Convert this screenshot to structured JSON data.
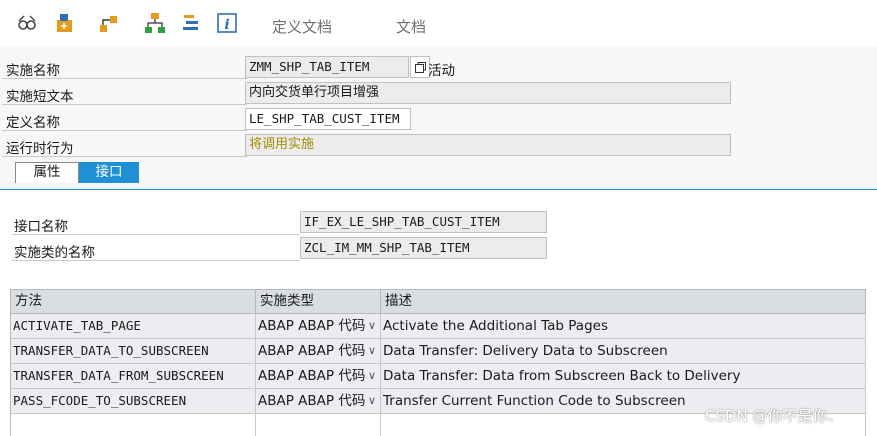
{
  "toolbar": {
    "icons": [
      "display-glasses-icon",
      "object-list-icon",
      "hierarchy-icon",
      "tree-structure-icon",
      "align-center-icon",
      "info-icon"
    ],
    "definition_doc_label": "定义文档",
    "doc_label": "文档"
  },
  "header": {
    "impl_name_label": "实施名称",
    "impl_name_value": "ZMM_SHP_TAB_ITEM",
    "active_label": "活动",
    "impl_short_text_label": "实施短文本",
    "impl_short_text_value": "内向交货单行项目增强",
    "definition_name_label": "定义名称",
    "definition_name_value": "LE_SHP_TAB_CUST_ITEM",
    "runtime_behavior_label": "运行时行为",
    "runtime_behavior_value": "将调用实施"
  },
  "tabs": [
    {
      "label": "属性",
      "active": false
    },
    {
      "label": "接口",
      "active": true
    }
  ],
  "interface": {
    "interface_name_label": "接口名称",
    "interface_name_value": "IF_EX_LE_SHP_TAB_CUST_ITEM",
    "impl_class_label": "实施类的名称",
    "impl_class_value": "ZCL_IM_MM_SHP_TAB_ITEM"
  },
  "methods": {
    "columns": [
      "方法",
      "实施类型",
      "描述"
    ],
    "rows": [
      {
        "method": "ACTIVATE_TAB_PAGE",
        "type": "ABAP ABAP 代码",
        "desc": "Activate the Additional Tab Pages"
      },
      {
        "method": "TRANSFER_DATA_TO_SUBSCREEN",
        "type": "ABAP ABAP 代码",
        "desc": "Data Transfer: Delivery Data to Subscreen"
      },
      {
        "method": "TRANSFER_DATA_FROM_SUBSCREEN",
        "type": "ABAP ABAP 代码",
        "desc": "Data Transfer: Data from Subscreen Back to Delivery"
      },
      {
        "method": "PASS_FCODE_TO_SUBSCREEN",
        "type": "ABAP ABAP 代码",
        "desc": "Transfer Current Function Code to Subscreen"
      }
    ]
  },
  "colors": {
    "accent": "#1f8fd6",
    "grid_header": "#dadde2",
    "runtime_value_text": "#a08a00"
  },
  "watermark": "CSDN @你不是你、"
}
